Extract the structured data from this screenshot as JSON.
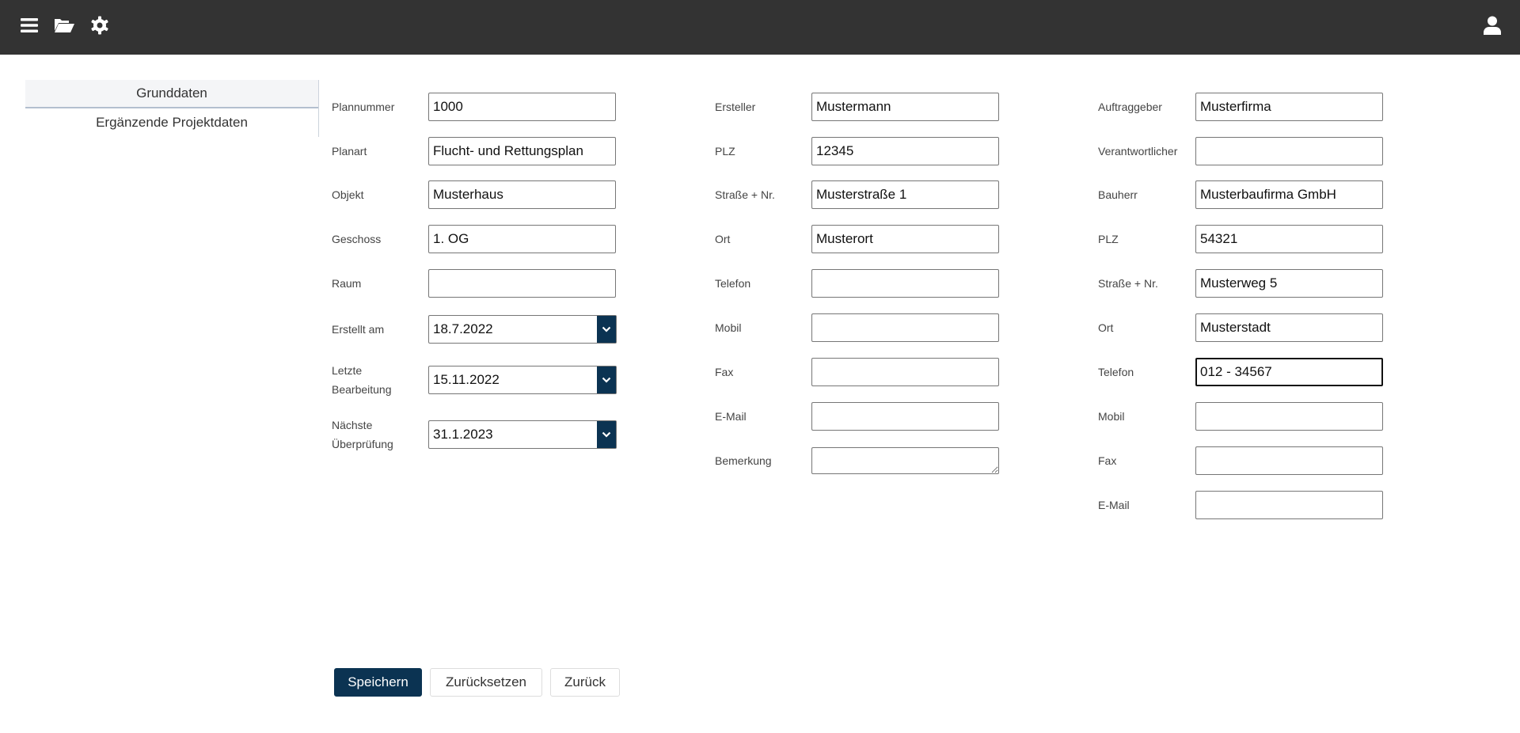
{
  "header": {
    "icons": [
      "menu-icon",
      "folder-open-icon",
      "gear-icon",
      "user-icon"
    ]
  },
  "sidebar": {
    "items": [
      {
        "label": "Grunddaten",
        "active": true
      },
      {
        "label": "Ergänzende Projektdaten",
        "active": false
      }
    ]
  },
  "form": {
    "col1": [
      {
        "label": "Plannummer",
        "value": "1000"
      },
      {
        "label": "Planart",
        "value": "Flucht- und Rettungsplan"
      },
      {
        "label": "Objekt",
        "value": "Musterhaus"
      },
      {
        "label": "Geschoss",
        "value": "1. OG"
      },
      {
        "label": "Raum",
        "value": ""
      }
    ],
    "dates": [
      {
        "label": "Erstellt am",
        "value": "18.7.2022"
      },
      {
        "label": "Letzte Bearbeitung",
        "value": "15.11.2022"
      },
      {
        "label": "Nächste Überprüfung",
        "value": "31.1.2023"
      }
    ],
    "col2": [
      {
        "label": "Ersteller",
        "value": "Mustermann"
      },
      {
        "label": "PLZ",
        "value": "12345"
      },
      {
        "label": "Straße + Nr.",
        "value": "Musterstraße 1"
      },
      {
        "label": "Ort",
        "value": "Musterort"
      },
      {
        "label": "Telefon",
        "value": ""
      },
      {
        "label": "Mobil",
        "value": ""
      },
      {
        "label": "Fax",
        "value": ""
      },
      {
        "label": "E-Mail",
        "value": ""
      },
      {
        "label": "Bemerkung",
        "value": ""
      }
    ],
    "col3": [
      {
        "label": "Auftraggeber",
        "value": "Musterfirma"
      },
      {
        "label": "Verantwortlicher",
        "value": ""
      },
      {
        "label": "Bauherr",
        "value": "Musterbaufirma GmbH"
      },
      {
        "label": "PLZ",
        "value": "54321"
      },
      {
        "label": "Straße + Nr.",
        "value": "Musterweg 5"
      },
      {
        "label": "Ort",
        "value": "Musterstadt"
      },
      {
        "label": "Telefon",
        "value": "012 - 34567",
        "focused": true
      },
      {
        "label": "Mobil",
        "value": ""
      },
      {
        "label": "Fax",
        "value": ""
      },
      {
        "label": "E-Mail",
        "value": ""
      }
    ]
  },
  "buttons": {
    "save": "Speichern",
    "reset": "Zurücksetzen",
    "back": "Zurück"
  },
  "colors": {
    "header": "#333333",
    "primary": "#0b3352"
  }
}
